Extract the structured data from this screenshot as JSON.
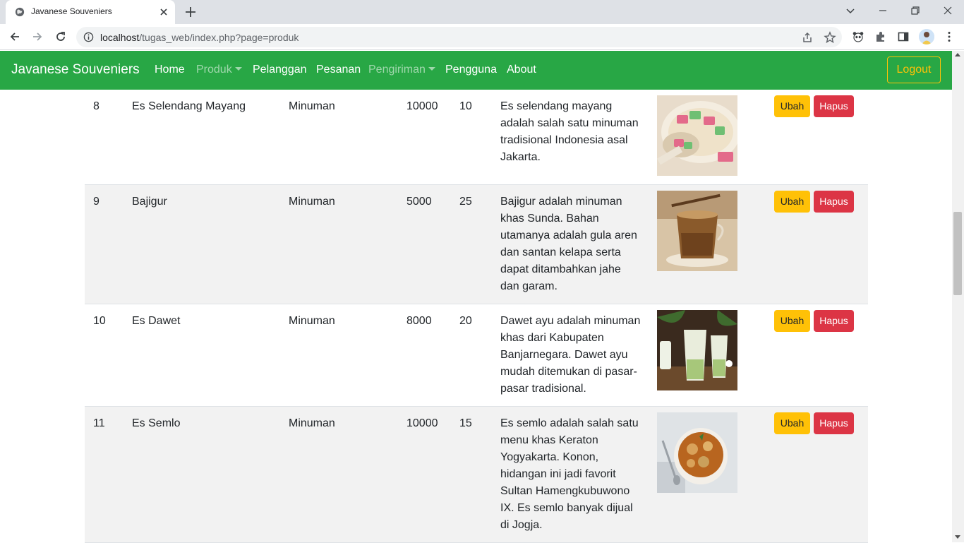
{
  "browser": {
    "tab_title": "Javanese Souveniers",
    "url_host": "localhost",
    "url_path": "/tugas_web/index.php?page=produk"
  },
  "navbar": {
    "brand": "Javanese Souveniers",
    "items": [
      {
        "label": "Home",
        "active": true,
        "dropdown": false
      },
      {
        "label": "Produk",
        "active": false,
        "dropdown": true
      },
      {
        "label": "Pelanggan",
        "active": true,
        "dropdown": false
      },
      {
        "label": "Pesanan",
        "active": true,
        "dropdown": false
      },
      {
        "label": "Pengiriman",
        "active": false,
        "dropdown": true
      },
      {
        "label": "Pengguna",
        "active": true,
        "dropdown": false
      },
      {
        "label": "About",
        "active": true,
        "dropdown": false
      }
    ],
    "logout_label": "Logout",
    "colors": {
      "bg": "#28a745",
      "logout": "#ffc107"
    }
  },
  "table": {
    "edit_label": "Ubah",
    "delete_label": "Hapus",
    "rows": [
      {
        "no": "8",
        "name": "Es Selendang Mayang",
        "category": "Minuman",
        "price": "10000",
        "stock": "10",
        "description": "Es selendang mayang adalah salah satu minuman tradisional Indonesia asal Jakarta."
      },
      {
        "no": "9",
        "name": "Bajigur",
        "category": "Minuman",
        "price": "5000",
        "stock": "25",
        "description": "Bajigur adalah minuman khas Sunda. Bahan utamanya adalah gula aren dan santan kelapa serta dapat ditambahkan jahe dan garam."
      },
      {
        "no": "10",
        "name": "Es Dawet",
        "category": "Minuman",
        "price": "8000",
        "stock": "20",
        "description": "Dawet ayu adalah minuman khas dari Kabupaten Banjarnegara. Dawet ayu mudah ditemukan di pasar-pasar tradisional."
      },
      {
        "no": "11",
        "name": "Es Semlo",
        "category": "Minuman",
        "price": "10000",
        "stock": "15",
        "description": "Es semlo adalah salah satu menu khas Keraton Yogyakarta. Konon, hidangan ini jadi favorit Sultan Hamengkubuwono IX. Es semlo banyak dijual di Jogja."
      }
    ]
  }
}
